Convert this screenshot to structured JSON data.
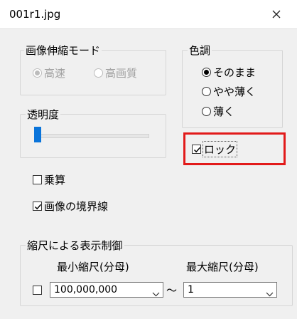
{
  "window": {
    "title": "001r1.jpg",
    "close_icon": "close-icon"
  },
  "interp_group": {
    "label": "画像伸縮モード",
    "options": [
      {
        "label": "高速",
        "selected": true,
        "enabled": false
      },
      {
        "label": "高画質",
        "selected": false,
        "enabled": false
      }
    ]
  },
  "tone_group": {
    "label": "色調",
    "options": [
      {
        "label": "そのまま",
        "selected": true
      },
      {
        "label": "やや薄く",
        "selected": false
      },
      {
        "label": "薄く",
        "selected": false
      }
    ]
  },
  "opacity_group": {
    "label": "透明度",
    "value_fraction": 0.0
  },
  "lock": {
    "label": "ロック",
    "checked": true
  },
  "multiply": {
    "label": "乗算",
    "checked": false
  },
  "border": {
    "label": "画像の境界線",
    "checked": true
  },
  "scale_group": {
    "label": "縮尺による表示制御",
    "enable_checked": false,
    "min_label": "最小縮尺(分母)",
    "max_label": "最大縮尺(分母)",
    "min_value": "100,000,000",
    "max_value": "1",
    "tilde": "～"
  },
  "colors": {
    "accent": "#0a74da",
    "highlight": "#e21a1a",
    "dialog_bg": "#f0f0f0"
  }
}
